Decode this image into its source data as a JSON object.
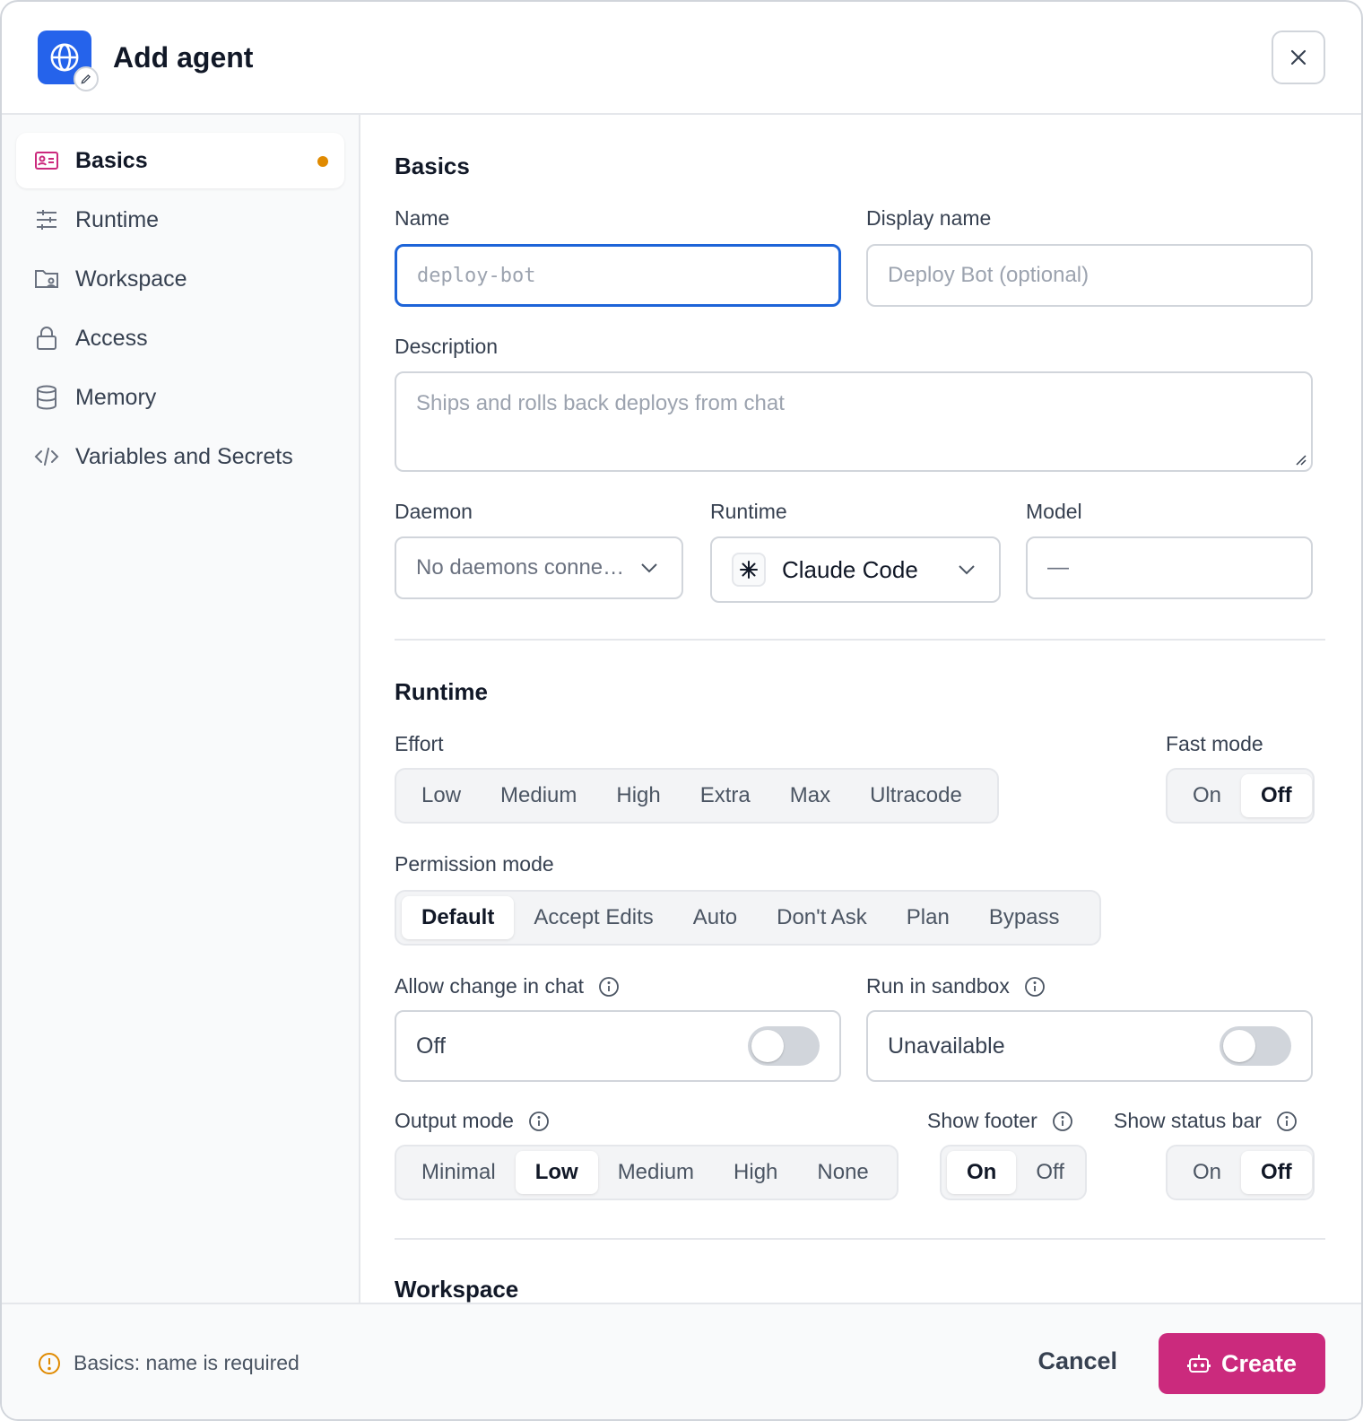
{
  "dialog": {
    "title": "Add agent"
  },
  "sidebar": {
    "items": [
      {
        "label": "Basics",
        "icon": "id-card-icon",
        "active": true
      },
      {
        "label": "Runtime",
        "icon": "sliders-icon"
      },
      {
        "label": "Workspace",
        "icon": "folder-user-icon"
      },
      {
        "label": "Access",
        "icon": "lock-icon"
      },
      {
        "label": "Memory",
        "icon": "database-icon"
      },
      {
        "label": "Variables and Secrets",
        "icon": "code-icon"
      }
    ]
  },
  "basics": {
    "title": "Basics",
    "name_label": "Name",
    "name_placeholder": "deploy-bot",
    "display_name_label": "Display name",
    "display_name_placeholder": "Deploy Bot (optional)",
    "description_label": "Description",
    "description_placeholder": "Ships and rolls back deploys from chat",
    "daemon_label": "Daemon",
    "daemon_value": "No daemons conne…",
    "runtime_label": "Runtime",
    "runtime_value": "Claude Code",
    "model_label": "Model",
    "model_value": "—"
  },
  "runtime": {
    "title": "Runtime",
    "effort_label": "Effort",
    "effort_options": [
      "Low",
      "Medium",
      "High",
      "Extra",
      "Max",
      "Ultracode"
    ],
    "fast_mode_label": "Fast mode",
    "fast_mode_options": [
      "On",
      "Off"
    ],
    "fast_mode_selected": "Off",
    "permission_label": "Permission mode",
    "permission_options": [
      "Default",
      "Accept Edits",
      "Auto",
      "Don't Ask",
      "Plan",
      "Bypass"
    ],
    "permission_selected": "Default",
    "allow_change_label": "Allow change in chat",
    "allow_change_value": "Off",
    "sandbox_label": "Run in sandbox",
    "sandbox_value": "Unavailable",
    "output_mode_label": "Output mode",
    "output_mode_options": [
      "Minimal",
      "Low",
      "Medium",
      "High",
      "None"
    ],
    "output_mode_selected": "Low",
    "show_footer_label": "Show footer",
    "show_footer_options": [
      "On",
      "Off"
    ],
    "show_footer_selected": "On",
    "show_status_label": "Show status bar",
    "show_status_options": [
      "On",
      "Off"
    ],
    "show_status_selected": "Off"
  },
  "workspace": {
    "title": "Workspace"
  },
  "footer": {
    "warning": "Basics: name is required",
    "cancel_label": "Cancel",
    "create_label": "Create"
  },
  "colors": {
    "accent": "#2563eb",
    "primary_button": "#cb2a7d",
    "warning": "#e08a00",
    "focus": "#1d64d8"
  }
}
